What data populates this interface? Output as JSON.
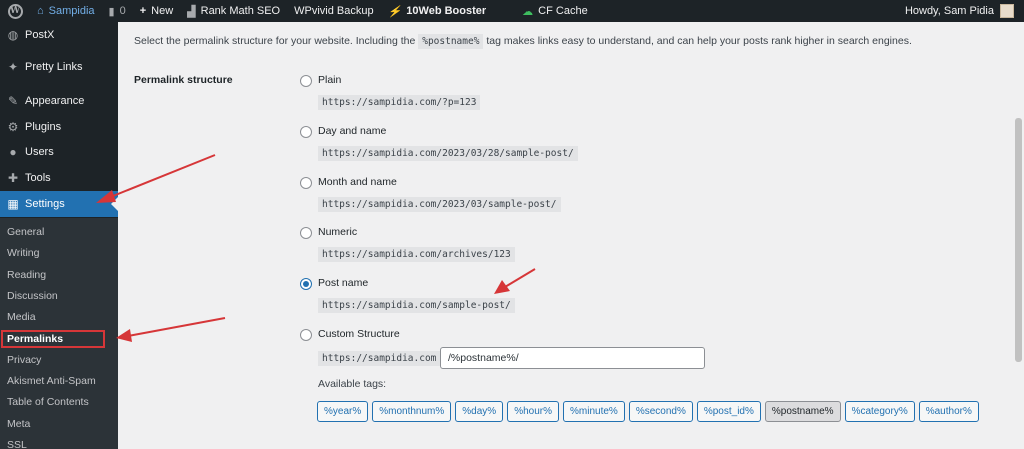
{
  "adminbar": {
    "site_name": "Sampidia",
    "comments_count": "0",
    "new_label": "New",
    "rankmath_label": "Rank Math SEO",
    "wpvivid_label": "WPvivid Backup",
    "booster_label": "10Web Booster",
    "cfcache_label": "CF Cache",
    "howdy": "Howdy, Sam Pidia"
  },
  "sidebar": {
    "items": [
      {
        "label": "PostX",
        "icon": "postx-icon"
      },
      {
        "label": "Pretty Links",
        "icon": "pretty-links-icon"
      },
      {
        "label": "Appearance",
        "icon": "appearance-icon"
      },
      {
        "label": "Plugins",
        "icon": "plugins-icon"
      },
      {
        "label": "Users",
        "icon": "users-icon"
      },
      {
        "label": "Tools",
        "icon": "tools-icon"
      },
      {
        "label": "Settings",
        "icon": "settings-icon"
      }
    ],
    "submenu": [
      "General",
      "Writing",
      "Reading",
      "Discussion",
      "Media",
      "Permalinks",
      "Privacy",
      "Akismet Anti-Spam",
      "Table of Contents",
      "Meta",
      "SSL"
    ]
  },
  "main": {
    "desc_before": "Select the permalink structure for your website. Including the",
    "desc_code": "%postname%",
    "desc_after": "tag makes links easy to understand, and can help your posts rank higher in search engines.",
    "section_label": "Permalink structure",
    "options": [
      {
        "label": "Plain",
        "example": "https://sampidia.com/?p=123",
        "checked": false
      },
      {
        "label": "Day and name",
        "example": "https://sampidia.com/2023/03/28/sample-post/",
        "checked": false
      },
      {
        "label": "Month and name",
        "example": "https://sampidia.com/2023/03/sample-post/",
        "checked": false
      },
      {
        "label": "Numeric",
        "example": "https://sampidia.com/archives/123",
        "checked": false
      },
      {
        "label": "Post name",
        "example": "https://sampidia.com/sample-post/",
        "checked": true
      },
      {
        "label": "Custom Structure",
        "checked": false
      }
    ],
    "custom_prefix": "https://sampidia.com",
    "custom_value": "/%postname%/",
    "available_tags_label": "Available tags:",
    "tags": [
      "%year%",
      "%monthnum%",
      "%day%",
      "%hour%",
      "%minute%",
      "%second%",
      "%post_id%",
      "%postname%",
      "%category%",
      "%author%"
    ],
    "active_tag": "%postname%"
  },
  "colors": {
    "admin_bg": "#1d2327",
    "accent": "#2271b1",
    "annotation_red": "#d63638"
  }
}
